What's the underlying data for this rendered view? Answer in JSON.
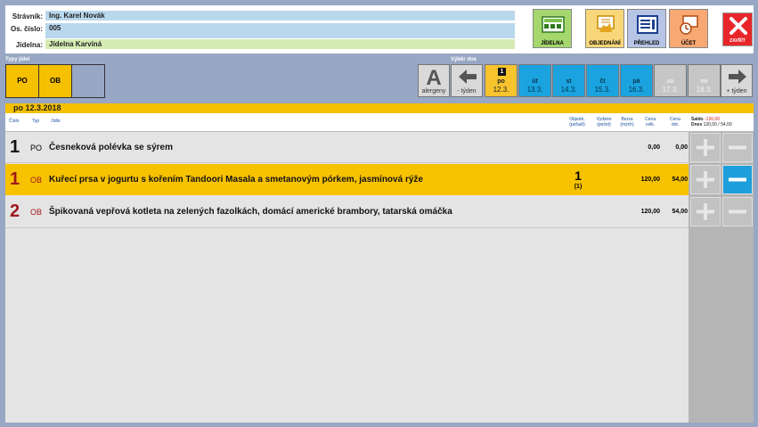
{
  "header": {
    "stravnik_label": "Strávník:",
    "stravnik_value": "Ing. Karel Novák",
    "os_cislo_label": "Os. číslo:",
    "os_cislo_value": "005",
    "jidelna_label": "Jídelna:",
    "jidelna_value": "Jídelna Karviná",
    "buttons": {
      "jidelna": "JÍDELNA",
      "objednani": "OBJEDNÁNÍ",
      "prehled": "PŘEHLED",
      "ucet": "ÚČET",
      "zavrit": "ZAVŘÍT"
    }
  },
  "types": {
    "label": "Typy jídel",
    "items": [
      "PO",
      "OB"
    ]
  },
  "day_select": {
    "label": "Výběr dne",
    "allergen_letter": "A",
    "allergen_label": "alergeny",
    "prev_label": "- týden",
    "next_label": "+ týden",
    "selected_badge": "1",
    "days": [
      {
        "day": "po",
        "date": "12.3."
      },
      {
        "day": "út",
        "date": "13.3."
      },
      {
        "day": "st",
        "date": "14.3."
      },
      {
        "day": "čt",
        "date": "15.3."
      },
      {
        "day": "pá",
        "date": "16.3."
      },
      {
        "day": "so",
        "date": "17.3."
      },
      {
        "day": "ne",
        "date": "18.3."
      }
    ]
  },
  "date_bar": "po 12.3.2018",
  "columns": {
    "cislo": "Číslo",
    "typ": "Typ",
    "jidlo": "Jídlo",
    "objedn_1": "Objedn.",
    "objedn_2": "(pořadí)",
    "vydano_1": "Vydáno",
    "vydano_2": "(počet)",
    "burza_1": "Burza",
    "burza_2": "(mých)",
    "cena_celk_1": "Cena",
    "cena_celk_2": "celk.",
    "cena_dot_1": "Cena",
    "cena_dot_2": "dot.",
    "saldo_label": "Saldo",
    "saldo_value": "-120,00",
    "dnes_label": "Dnes",
    "dnes_value": "120,00 / 54,00"
  },
  "rows": [
    {
      "no": "1",
      "type": "PO",
      "name": "Česneková polévka se sýrem",
      "ord": "",
      "ord_sub": "",
      "price": "0,00",
      "price_dot": "0,00"
    },
    {
      "no": "1",
      "type": "OB",
      "name": "Kuřecí prsa v jogurtu s kořením Tandoori Masala a smetanovým pórkem, jasmínová rýže",
      "ord": "1",
      "ord_sub": "(1)",
      "price": "120,00",
      "price_dot": "54,00"
    },
    {
      "no": "2",
      "type": "OB",
      "name": "Špikovaná vepřová kotleta na zelených fazolkách, domácí americké brambory, tatarská omáčka",
      "ord": "",
      "ord_sub": "",
      "price": "120,00",
      "price_dot": "54,00"
    }
  ],
  "colors": {
    "selected_row": "#f7c200",
    "day_selected": "#f7c42e",
    "day_weekday": "#1aa3df",
    "number_red": "#a0191d",
    "minus_active": "#1d9fdc"
  }
}
